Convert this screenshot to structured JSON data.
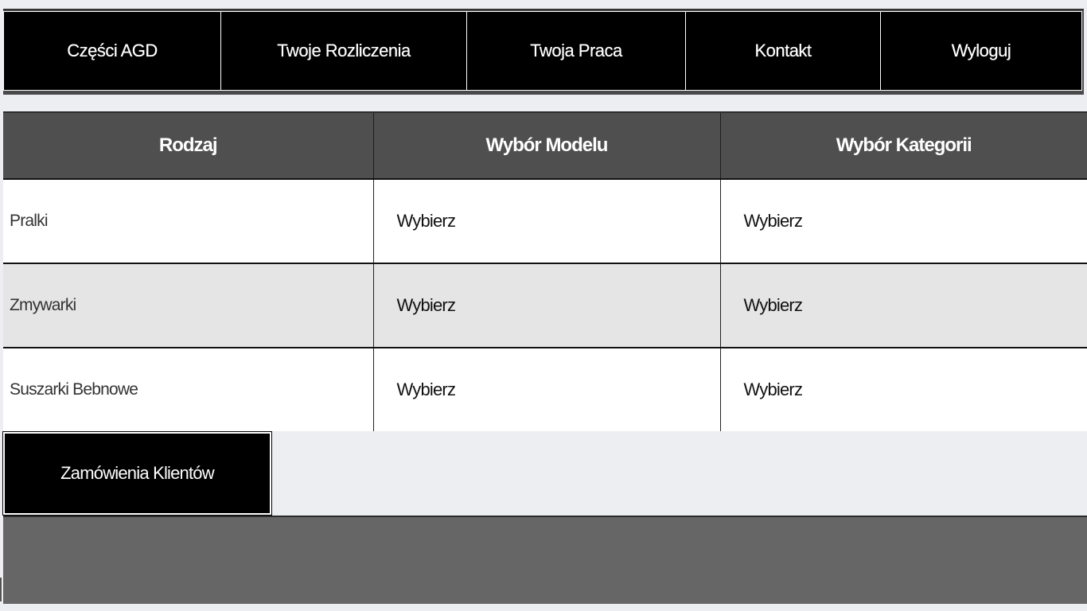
{
  "nav": {
    "items": [
      {
        "label": "Części AGD"
      },
      {
        "label": "Twoje Rozliczenia"
      },
      {
        "label": "Twoja Praca"
      },
      {
        "label": "Kontakt"
      },
      {
        "label": "Wyloguj"
      }
    ]
  },
  "table": {
    "headers": [
      "Rodzaj",
      "Wybór Modelu",
      "Wybór Kategorii"
    ],
    "rows": [
      {
        "kind": "Pralki",
        "model": "Wybierz",
        "category": "Wybierz"
      },
      {
        "kind": "Zmywarki",
        "model": "Wybierz",
        "category": "Wybierz"
      },
      {
        "kind": "Suszarki Bebnowe",
        "model": "Wybierz",
        "category": "Wybierz"
      }
    ]
  },
  "orders_button": {
    "label": "Zamówienia Klientów"
  },
  "colors": {
    "nav_bg": "#000000",
    "header_bg": "#4f4f4f",
    "row_alt": "#e5e5e5",
    "footer_bg": "#666666",
    "page_bg": "#edeef2"
  }
}
